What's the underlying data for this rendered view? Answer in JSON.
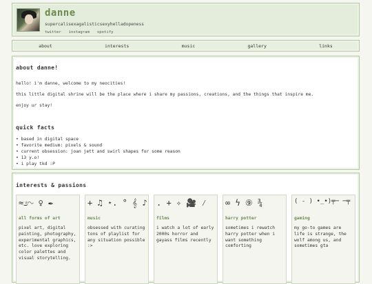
{
  "header": {
    "title": "danne",
    "tagline": "supercalisexagalisticsexyhelladopeness",
    "social": [
      "twitter",
      "instagram",
      "spotify"
    ]
  },
  "nav": [
    "about",
    "interests",
    "music",
    "gallery",
    "links"
  ],
  "about": {
    "heading": "about danne!",
    "paragraphs": [
      "hello! i'm danne, welcome to my neocities!",
      "this little digital shrine will be the place where i share my passions, creations, and the things that inspire me.",
      "enjoy ur stay!"
    ],
    "facts_heading": "quick facts",
    "facts": [
      "• based in digital space",
      "• favorite medium: pixels & sound",
      "• current obsession: joan jett and swirl shapes for some reason",
      "• 13 y.o!",
      "• i play tkd :P"
    ]
  },
  "interests": {
    "heading": "interests & passions",
    "cards": [
      {
        "art": "≈೨∿ ♀ ✒",
        "title": "all forms of art",
        "desc": "pixel art, digital painting, photography, experimental graphics, etc. love exploring color palettes and visual storytelling."
      },
      {
        "art": "+ ♫ ⋆. ° 𝄞 ♪",
        "title": "music",
        "desc": "obsessed with curating tons of playlist for any situation possible :>"
      },
      {
        "art": ". + ✧  🎥 ⁄",
        "title": "films",
        "desc": "i watch a lot of early 2000s horror and gayass films recently"
      },
      {
        "art": "∞ ϟ ⑨ ¾",
        "title": "harry potter",
        "desc": "sometimes i rewatch harry potter when i want something comforting"
      },
      {
        "art": "( - ) •_•)╤─ ─╤",
        "title": "gaming",
        "desc": "my go-to games are life is strange, the wolf among us, and sometimes gta"
      }
    ]
  },
  "colors": {
    "accent": "#6b8a4e",
    "panel_border": "#b5c8a5",
    "header_bg": "#e4eddb"
  }
}
